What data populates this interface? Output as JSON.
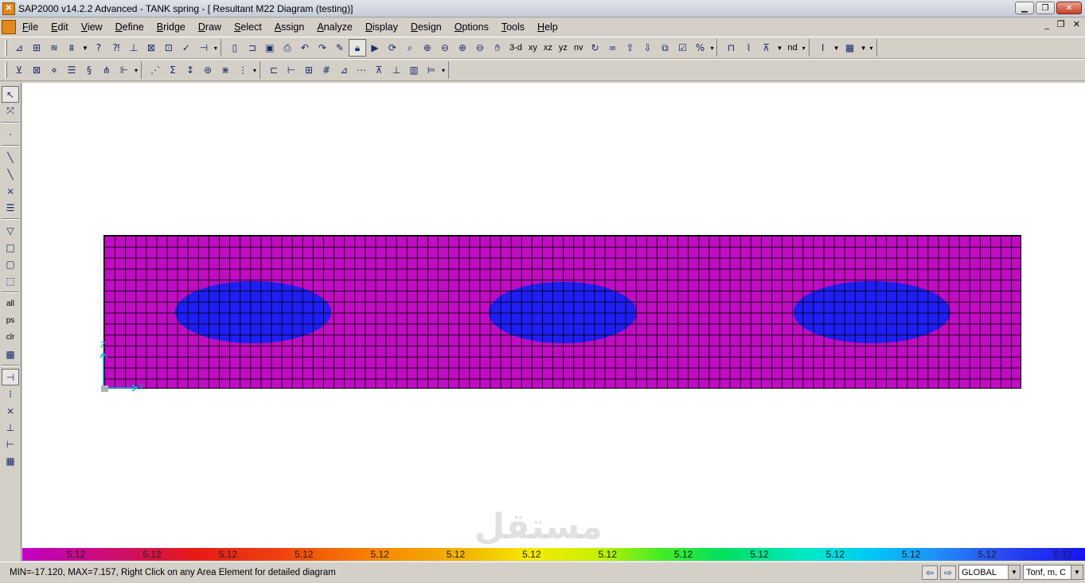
{
  "window": {
    "title": "SAP2000 v14.2.2 Advanced  - TANK spring - [  Resultant M22 Diagram   (testing)]",
    "controls": {
      "minimize": "▁",
      "maximize": "❐",
      "close": "✕"
    }
  },
  "menu": {
    "items": [
      "File",
      "Edit",
      "View",
      "Define",
      "Bridge",
      "Draw",
      "Select",
      "Assign",
      "Analyze",
      "Display",
      "Design",
      "Options",
      "Tools",
      "Help"
    ],
    "mdi": {
      "minimize": "_",
      "restore": "❐",
      "close": "✕"
    }
  },
  "toolbar1": {
    "view_labels": [
      "3-d",
      "xy",
      "xz",
      "yz",
      "nv"
    ],
    "nd_label": "nd"
  },
  "leftbar": {
    "labels": [
      "all",
      "ps",
      "clr"
    ]
  },
  "legend": {
    "values": [
      "5.12",
      "5.12",
      "5.12",
      "5.12",
      "5.12",
      "5.12",
      "5.12",
      "5.12",
      "5.12",
      "5.12",
      "5.12",
      "5.12",
      "5.12",
      "5.12"
    ]
  },
  "canvas": {
    "axis_x": "X",
    "axis_z": "Z",
    "watermark": "مستقل",
    "colors": {
      "plate": "#c00cc2",
      "blob": "#1f1ff5"
    }
  },
  "status": {
    "text": "MIN=-17.120, MAX=7.157, Right Click on any Area Element for detailed diagram",
    "coord_system": "GLOBAL",
    "units": "Tonf, m, C"
  }
}
